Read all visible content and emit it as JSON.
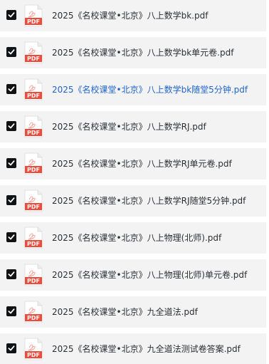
{
  "files": [
    {
      "name": "2025《名校课堂•北京》八上数学bk.pdf",
      "checked": true,
      "highlight": false
    },
    {
      "name": "2025《名校课堂•北京》八上数学bk单元卷.pdf",
      "checked": true,
      "highlight": false
    },
    {
      "name": "2025《名校课堂•北京》八上数学bk随堂5分钟.pdf",
      "checked": true,
      "highlight": true
    },
    {
      "name": "2025《名校课堂•北京》八上数学RJ.pdf",
      "checked": true,
      "highlight": false
    },
    {
      "name": "2025《名校课堂•北京》八上数学RJ单元卷.pdf",
      "checked": true,
      "highlight": false
    },
    {
      "name": "2025《名校课堂•北京》八上数学RJ随堂5分钟.pdf",
      "checked": true,
      "highlight": false
    },
    {
      "name": "2025《名校课堂•北京》八上物理(北师).pdf",
      "checked": true,
      "highlight": false
    },
    {
      "name": "2025《名校课堂•北京》八上物理(北师)单元卷.pdf",
      "checked": true,
      "highlight": false
    },
    {
      "name": "2025《名校课堂•北京》九全道法.pdf",
      "checked": true,
      "highlight": false
    },
    {
      "name": "2025《名校课堂•北京》九全道法测试卷答案.pdf",
      "checked": true,
      "highlight": false
    }
  ],
  "icon_label": "PDF",
  "colors": {
    "row_background": "#f3f3f4",
    "text": "#2b2f33",
    "highlight_text": "#1f64cc",
    "pdf_red": "#f04a3b",
    "checkbox": "#101214"
  },
  "icons": {
    "checkbox": "checkmark-icon",
    "file": "pdf-file-icon"
  }
}
